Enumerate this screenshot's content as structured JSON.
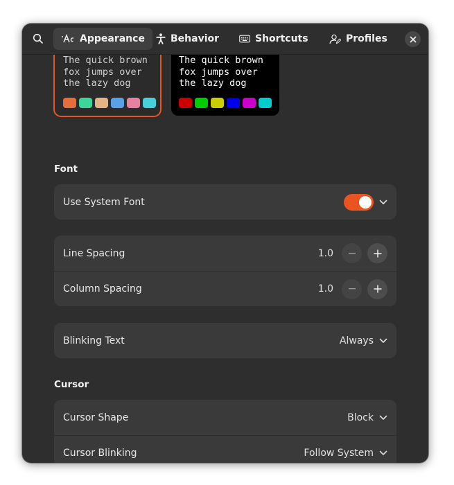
{
  "header": {
    "tabs": [
      {
        "label": "Appearance",
        "icon": "appearance-icon",
        "active": true
      },
      {
        "label": "Behavior",
        "icon": "accessibility-icon",
        "active": false
      },
      {
        "label": "Shortcuts",
        "icon": "keyboard-icon",
        "active": false
      },
      {
        "label": "Profiles",
        "icon": "profile-icon",
        "active": false
      }
    ],
    "search_icon": "search-icon",
    "close_icon": "close-icon"
  },
  "previews": [
    {
      "text": "The quick brown\nfox jumps over\nthe lazy dog",
      "selected": true,
      "background": "#2b2b2b",
      "foreground": "#d0d0d0",
      "border": "#e95420",
      "swatches": [
        "#e66e3c",
        "#3cd69b",
        "#e3b485",
        "#5aa0e6",
        "#e682a0",
        "#46d2dc"
      ]
    },
    {
      "text": "The quick brown\nfox jumps over\nthe lazy dog",
      "selected": false,
      "background": "#000000",
      "foreground": "#ffffff",
      "border": "",
      "swatches": [
        "#cd0000",
        "#00cd00",
        "#cdcd00",
        "#0000ee",
        "#cd00cd",
        "#00cdcd"
      ]
    }
  ],
  "font": {
    "title": "Font",
    "use_system_font": {
      "label": "Use System Font",
      "enabled": true
    },
    "line_spacing": {
      "label": "Line Spacing",
      "value": "1.0"
    },
    "column_spacing": {
      "label": "Column Spacing",
      "value": "1.0"
    },
    "blinking_text": {
      "label": "Blinking Text",
      "value": "Always"
    }
  },
  "cursor": {
    "title": "Cursor",
    "shape": {
      "label": "Cursor Shape",
      "value": "Block"
    },
    "blinking": {
      "label": "Cursor Blinking",
      "value": "Follow System"
    }
  },
  "colors": {
    "accent": "#e95420",
    "window_bg": "#2e2e2e",
    "card_bg": "#3a3a3a"
  }
}
